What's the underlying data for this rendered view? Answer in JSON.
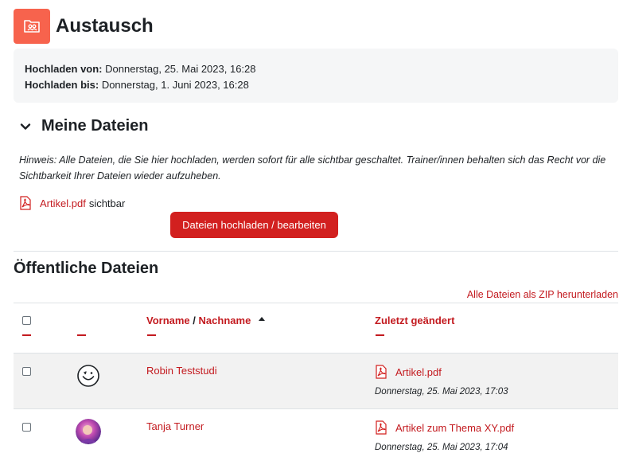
{
  "page": {
    "title": "Austausch",
    "activity_icon": "folder-users-icon"
  },
  "dates": {
    "from_label": "Hochladen von:",
    "from_value": "Donnerstag, 25. Mai 2023, 16:28",
    "to_label": "Hochladen bis:",
    "to_value": "Donnerstag, 1. Juni 2023, 16:28"
  },
  "my_files": {
    "title": "Meine Dateien",
    "hint": "Hinweis: Alle Dateien, die Sie hier hochladen, werden sofort für alle sichtbar geschaltet. Trainer/innen behalten sich das Recht vor die Sichtbarkeit Ihrer Dateien wieder aufzuheben.",
    "file_name": "Artikel.pdf",
    "visibility": "sichtbar",
    "upload_button": "Dateien hochladen / bearbeiten"
  },
  "public_files": {
    "title": "Öffentliche Dateien",
    "zip_link": "Alle Dateien als ZIP herunterladen",
    "headers": {
      "first_name": "Vorname",
      "separator": "/",
      "last_name": "Nachname",
      "modified": "Zuletzt geändert"
    },
    "rows": [
      {
        "name": "Robin Teststudi",
        "avatar": "smiley-avatar-icon",
        "file": "Artikel.pdf",
        "modified": "Donnerstag, 25. Mai 2023, 17:03"
      },
      {
        "name": "Tanja Turner",
        "avatar": "user-photo-avatar",
        "file": "Artikel zum Thema XY.pdf",
        "modified": "Donnerstag, 25. Mai 2023, 17:04"
      }
    ]
  },
  "colors": {
    "accent": "#c31a1f",
    "button": "#d2201f",
    "activity_icon_bg": "#f7634d",
    "date_box_bg": "#f5f6f7"
  }
}
